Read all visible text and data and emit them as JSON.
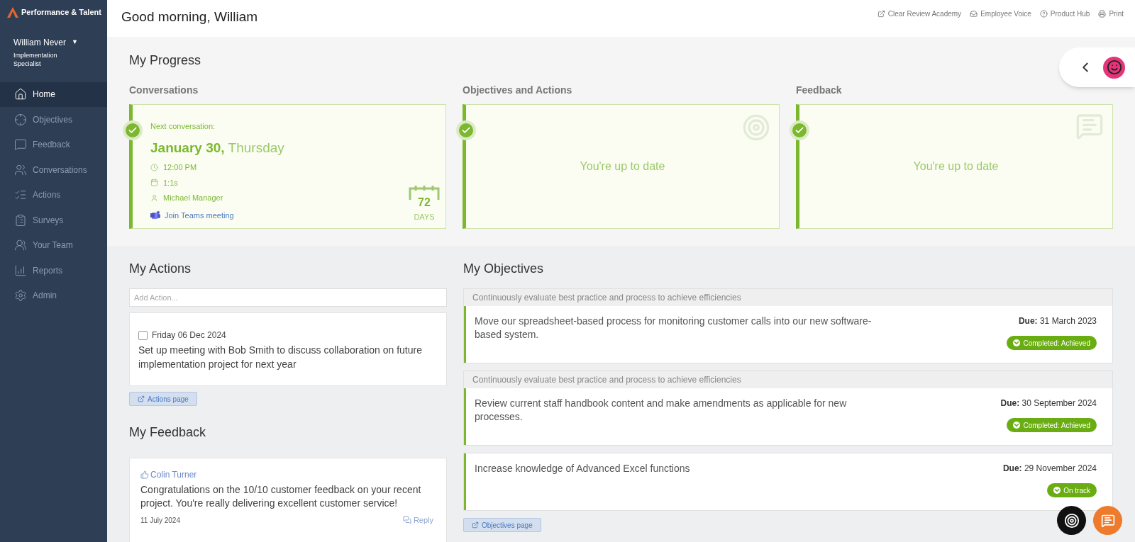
{
  "brand": {
    "name": "Performance & Talent"
  },
  "user": {
    "name": "William Never",
    "caret": "▼",
    "role": "Implementation Specialist"
  },
  "sidebar": {
    "items": [
      {
        "label": "Home",
        "selected": true
      },
      {
        "label": "Objectives",
        "selected": false
      },
      {
        "label": "Feedback",
        "selected": false
      },
      {
        "label": "Conversations",
        "selected": false
      },
      {
        "label": "Actions",
        "selected": false
      },
      {
        "label": "Surveys",
        "selected": false
      },
      {
        "label": "Your Team",
        "selected": false
      },
      {
        "label": "Reports",
        "selected": false
      },
      {
        "label": "Admin",
        "selected": false
      }
    ]
  },
  "header": {
    "greeting": "Good morning, William",
    "links": [
      {
        "label": "Clear Review Academy"
      },
      {
        "label": "Employee Voice"
      },
      {
        "label": "Product Hub"
      },
      {
        "label": "Print"
      }
    ]
  },
  "progress": {
    "title": "My Progress",
    "cards": [
      {
        "kind": "conversation",
        "title": "Conversations",
        "done": true,
        "next_label": "Next conversation:",
        "date": "January 30,",
        "weekday": "Thursday",
        "time": "12:00 PM",
        "type": "1:1s",
        "manager": "Michael Manager",
        "link": "Join Teams meeting",
        "days": "72",
        "days_label": "DAYS"
      },
      {
        "kind": "empty",
        "title": "Objectives and Actions",
        "done": true,
        "message": "You're up to date"
      },
      {
        "kind": "empty",
        "title": "Feedback",
        "done": true,
        "message": "You're up to date"
      }
    ]
  },
  "actions": {
    "title": "My Actions",
    "placeholder": "Add Action...",
    "items": [
      {
        "checked": false,
        "date": "Friday 06 Dec 2024",
        "text": "Set up meeting with Bob Smith to discuss collaboration on future implementation project for next year"
      }
    ],
    "page_button": "Actions page"
  },
  "feedback": {
    "title": "My Feedback",
    "items": [
      {
        "from": "Colin Turner",
        "text": "Congratulations on the 10/10 customer feedback on your recent project. You're really delivering excellent customer service!",
        "date": "11 July 2024",
        "reply": "Reply"
      }
    ]
  },
  "objectives": {
    "title": "My Objectives",
    "items": [
      {
        "parent": "Continuously evaluate best practice and process to achieve efficiencies",
        "text": "Move our spreadsheet-based process for monitoring customer calls into our new software-based system.",
        "due": "**Due:** 31 March 2023",
        "status": "Completed: Achieved"
      },
      {
        "parent": "Continuously evaluate best practice and process to achieve efficiencies",
        "text": "Review current staff handbook content and make amendments as applicable for new processes.",
        "due": "**Due:** 30 September 2024",
        "status": "Completed: Achieved"
      },
      {
        "text": "Increase knowledge of Advanced Excel functions",
        "due": "**Due:** 29 November 2024",
        "status": "On track"
      }
    ],
    "page_button": "Objectives page"
  }
}
